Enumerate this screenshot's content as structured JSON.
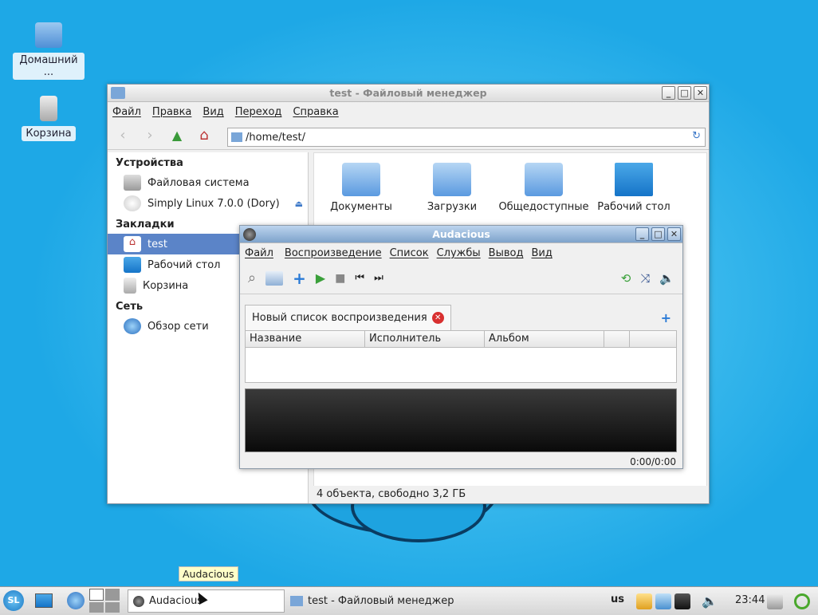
{
  "desktop": {
    "icons": [
      {
        "label": "Домашний ...",
        "icon": "home-folder-icon"
      },
      {
        "label": "Корзина",
        "icon": "trash-icon"
      }
    ]
  },
  "fm": {
    "title": "test - Файловый менеджер",
    "menu": [
      "Файл",
      "Правка",
      "Вид",
      "Переход",
      "Справка"
    ],
    "address": "/home/test/",
    "side": {
      "devices_header": "Устройства",
      "devices": [
        "Файловая система",
        "Simply Linux 7.0.0  (Dory)"
      ],
      "bookmarks_header": "Закладки",
      "bookmarks": [
        "test",
        "Рабочий стол",
        "Корзина"
      ],
      "network_header": "Сеть",
      "network": [
        "Обзор сети"
      ]
    },
    "files": [
      "Документы",
      "Загрузки",
      "Общедоступные",
      "Рабочий стол"
    ],
    "status": "4 объекта, свободно 3,2 ГБ"
  },
  "aud": {
    "title": "Audacious",
    "menu": [
      "Файл",
      "Воспроизведение",
      "Список",
      "Службы",
      "Вывод",
      "Вид"
    ],
    "tab": "Новый список воспроизведения",
    "columns": [
      "Название",
      "Исполнитель",
      "Альбом"
    ],
    "time": "0:00/0:00"
  },
  "taskbar": {
    "tooltip": "Audacious",
    "tasks": [
      "Audacious",
      "test - Файловый менеджер"
    ],
    "lang": "us",
    "clock": "23:44"
  },
  "colors": {
    "selection": "#5b84c8",
    "desktop": "#1ea8e6"
  }
}
